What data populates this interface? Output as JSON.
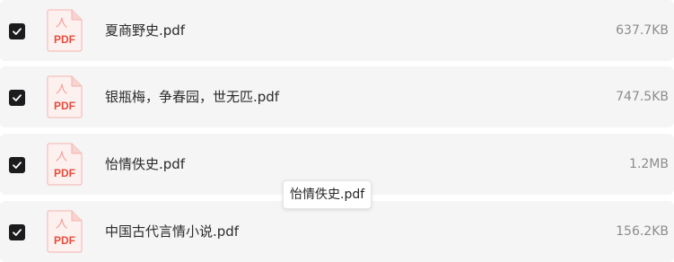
{
  "files": [
    {
      "name": "夏商野史.pdf",
      "size": "637.7KB",
      "checked": true,
      "icon": "pdf-file-icon"
    },
    {
      "name": "银瓶梅，争春园，世无匹.pdf",
      "size": "747.5KB",
      "checked": true,
      "icon": "pdf-file-icon"
    },
    {
      "name": "怡情佚史.pdf",
      "size": "1.2MB",
      "checked": true,
      "icon": "pdf-file-icon"
    },
    {
      "name": "中国古代言情小说.pdf",
      "size": "156.2KB",
      "checked": true,
      "icon": "pdf-file-icon"
    }
  ],
  "pdf_icon_label": "PDF",
  "tooltip": {
    "text": "怡情佚史.pdf"
  },
  "colors": {
    "row_background": "#f5f5f6",
    "checkbox_fill": "#1c1c1e",
    "pdf_red": "#e84c3d",
    "size_text": "#8c8c8c"
  }
}
